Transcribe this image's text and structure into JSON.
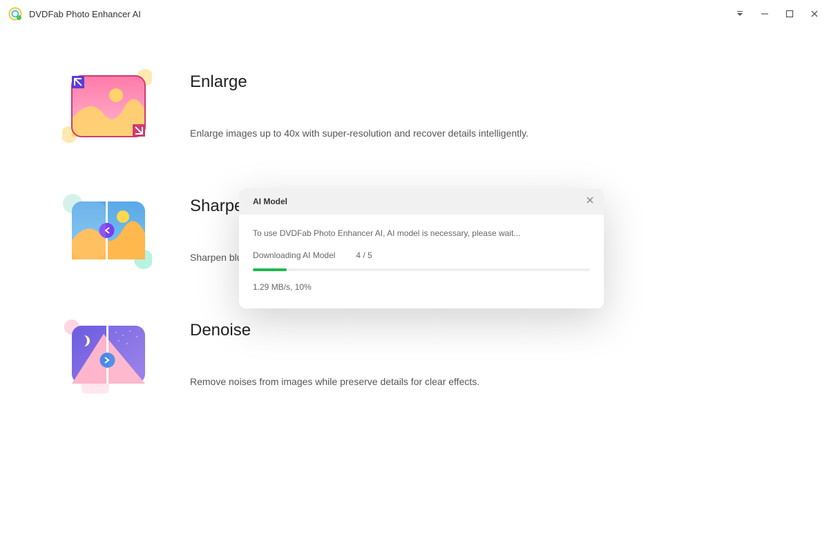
{
  "titlebar": {
    "app_title": "DVDFab Photo Enhancer AI"
  },
  "features": {
    "enlarge": {
      "title": "Enlarge",
      "desc": "Enlarge images up to 40x with super-resolution and recover details intelligently."
    },
    "sharpen": {
      "title": "Sharpen",
      "desc": "Sharpen blu"
    },
    "denoise": {
      "title": "Denoise",
      "desc": "Remove noises from images while preserve details for clear effects."
    }
  },
  "modal": {
    "title": "AI Model",
    "message": "To use DVDFab Photo Enhancer AI, AI model is necessary, please wait...",
    "downloading_label": "Downloading AI Model",
    "count": "4 / 5",
    "speed": "1.29 MB/s,   10%",
    "progress_percent": "10%"
  }
}
